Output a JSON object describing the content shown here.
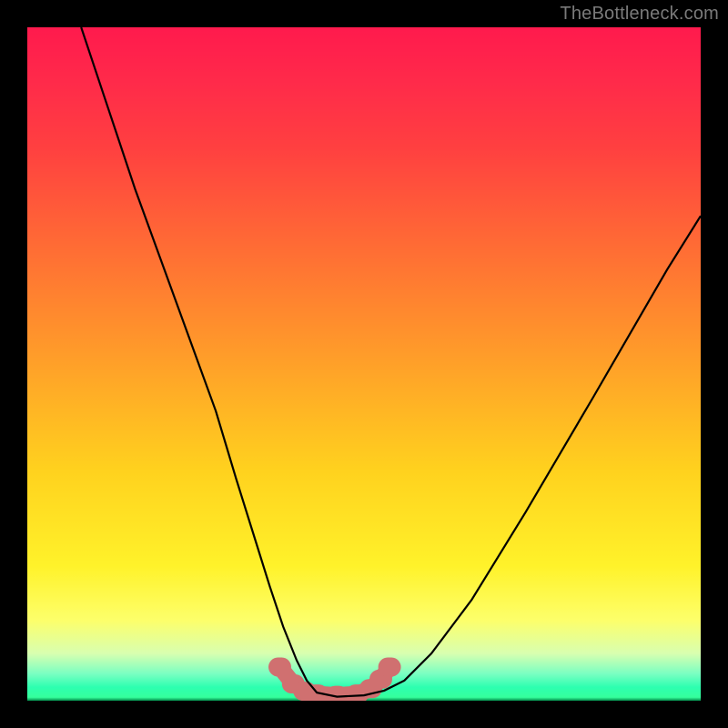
{
  "watermark": "TheBottleneck.com",
  "chart_data": {
    "type": "line",
    "title": "",
    "xlabel": "",
    "ylabel": "",
    "xlim": [
      0,
      100
    ],
    "ylim": [
      0,
      100
    ],
    "grid": false,
    "legend": false,
    "background_gradient": {
      "stops": [
        {
          "pos": 0,
          "color": "#ff1a4d"
        },
        {
          "pos": 0.18,
          "color": "#ff4040"
        },
        {
          "pos": 0.48,
          "color": "#ff9a2a"
        },
        {
          "pos": 0.8,
          "color": "#fff22a"
        },
        {
          "pos": 0.96,
          "color": "#7affc2"
        },
        {
          "pos": 1.0,
          "color": "#028c4c"
        }
      ]
    },
    "series": [
      {
        "name": "curve",
        "stroke": "#000000",
        "stroke_width": 2,
        "x": [
          8,
          12,
          16,
          20,
          24,
          28,
          31,
          33.5,
          36,
          38,
          40,
          41.5,
          43,
          46,
          50,
          53,
          56,
          60,
          66,
          74,
          84,
          95,
          100
        ],
        "y": [
          100,
          88,
          76,
          65,
          54,
          43,
          33,
          25,
          17,
          11,
          6,
          3,
          1.2,
          0.6,
          0.8,
          1.5,
          3,
          7,
          15,
          28,
          45,
          64,
          72
        ]
      },
      {
        "name": "bottom-markers",
        "stroke": "#d07070",
        "stroke_width": 14,
        "marker": "round",
        "x": [
          37.5,
          39.5,
          41.2,
          43,
          46,
          49,
          51,
          52.5,
          53.8
        ],
        "y": [
          5.0,
          2.5,
          1.4,
          1.0,
          0.8,
          1.0,
          1.8,
          3.2,
          5.0
        ]
      }
    ]
  }
}
